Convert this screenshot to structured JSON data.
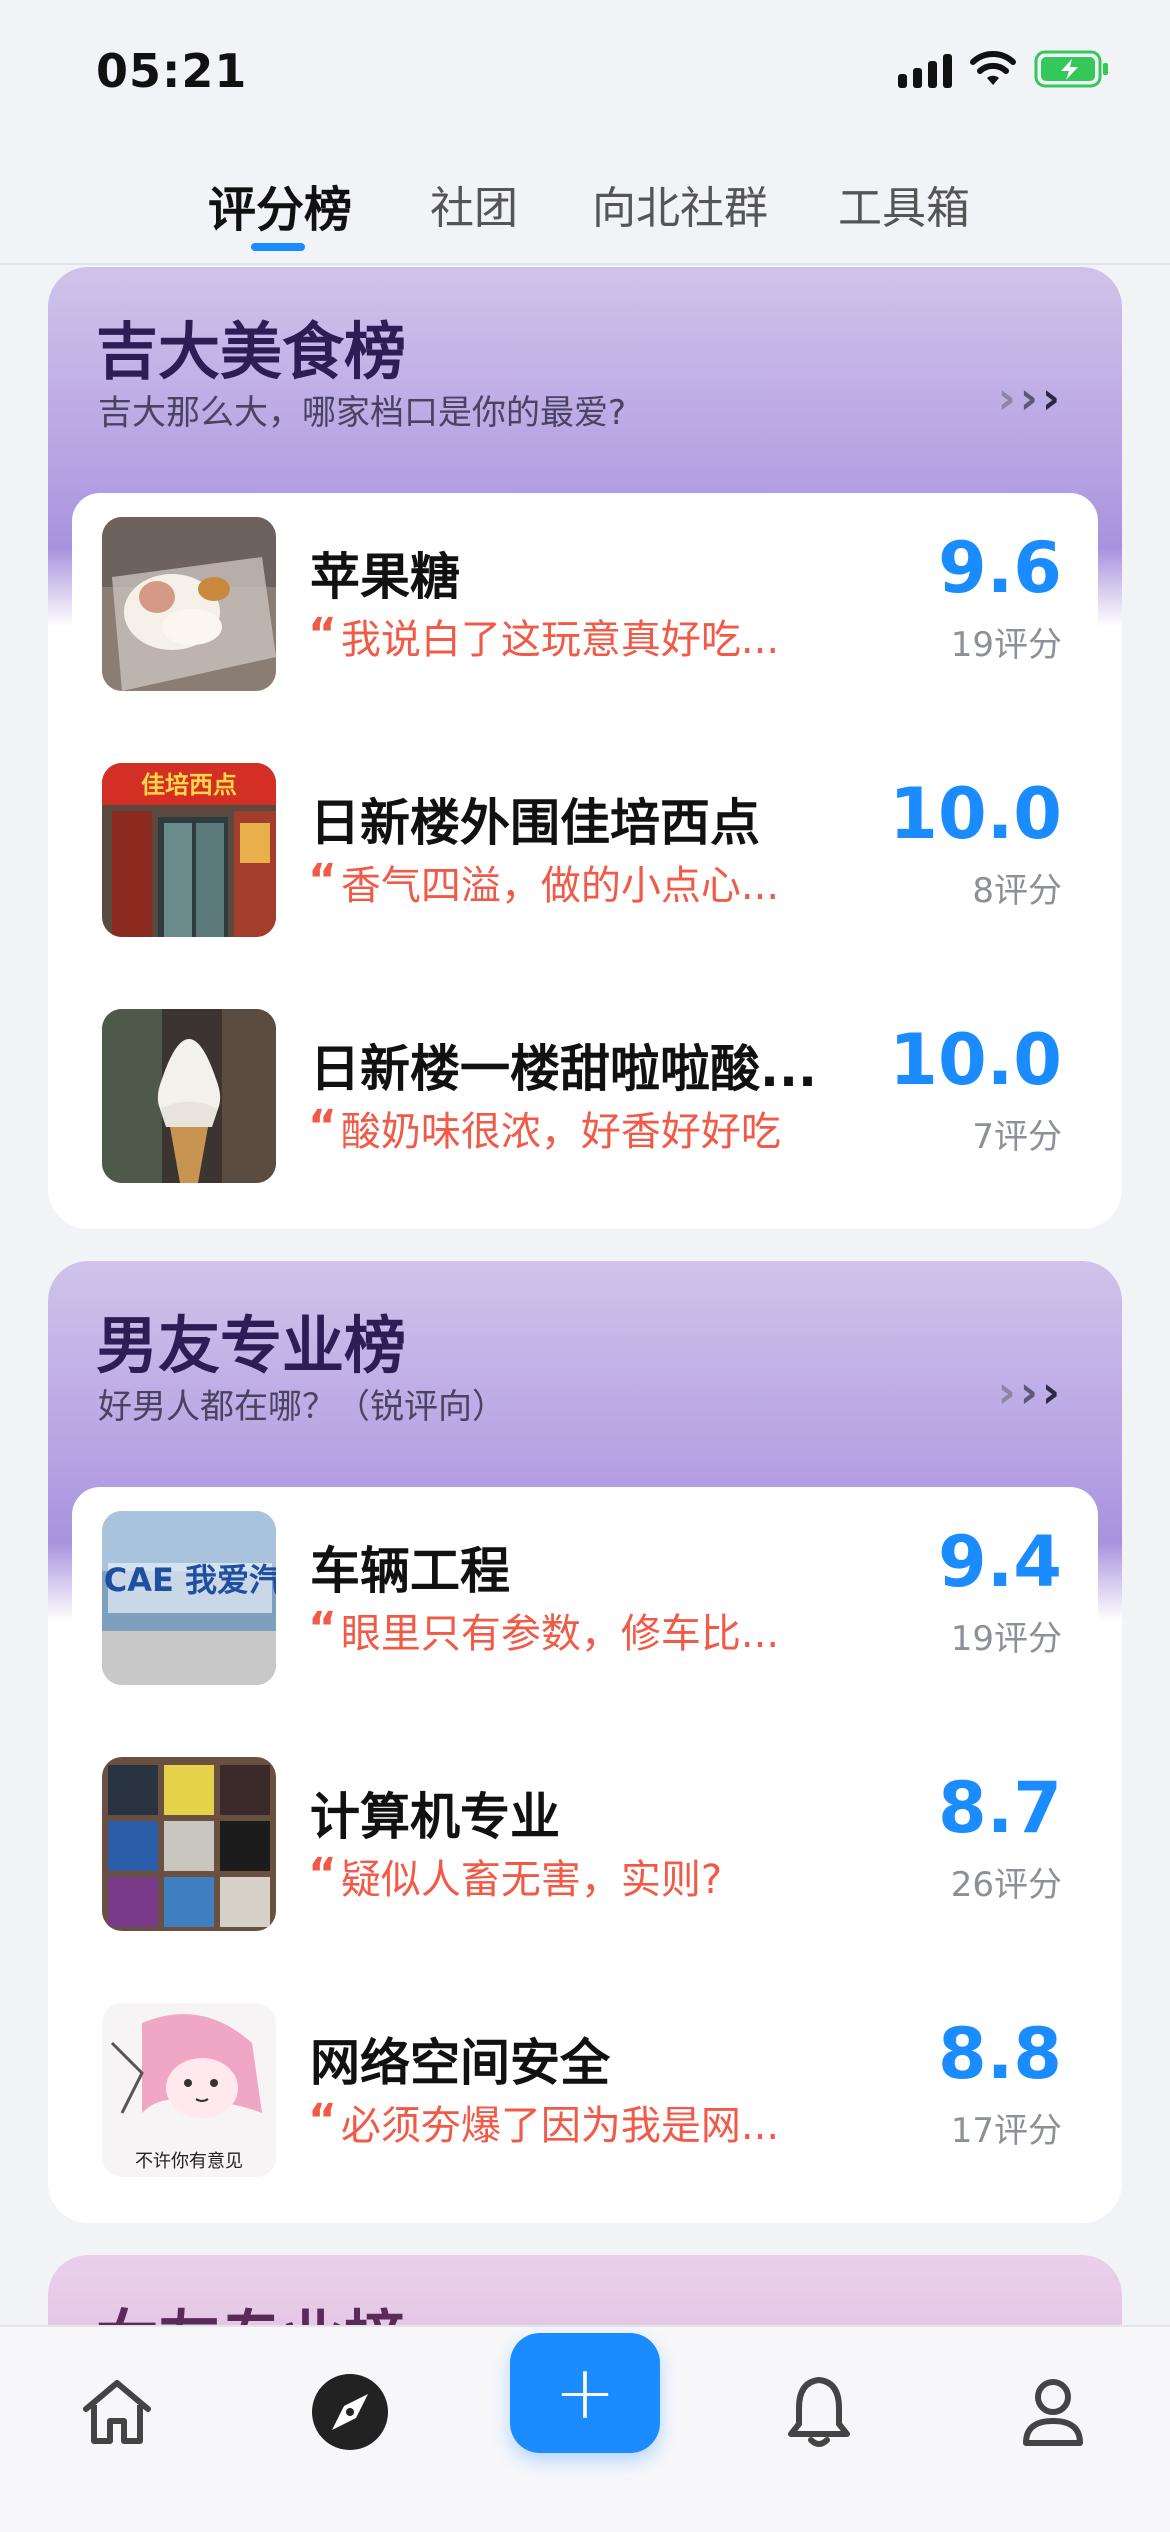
{
  "status": {
    "time": "05:21"
  },
  "tabs": [
    {
      "label": "评分榜"
    },
    {
      "label": "社团"
    },
    {
      "label": "向北社群"
    },
    {
      "label": "工具箱"
    }
  ],
  "boards": [
    {
      "title": "吉大美食榜",
      "subtitle": "吉大那么大，哪家档口是你的最爱?",
      "items": [
        {
          "name": "苹果糖",
          "quote": "我说白了这玩意真好吃...",
          "score": "9.6",
          "count": "19评分"
        },
        {
          "name": "日新楼外围佳培西点",
          "quote": "香气四溢，做的小点心...",
          "score": "10.0",
          "count": "8评分"
        },
        {
          "name": "日新楼一楼甜啦啦酸...",
          "quote": "酸奶味很浓，好香好好吃",
          "score": "10.0",
          "count": "7评分"
        }
      ]
    },
    {
      "title": "男友专业榜",
      "subtitle": "好男人都在哪？（锐评向）",
      "items": [
        {
          "name": "车辆工程",
          "quote": "眼里只有参数，修车比...",
          "score": "9.4",
          "count": "19评分"
        },
        {
          "name": "计算机专业",
          "quote": "疑似人畜无害，实则?",
          "score": "8.7",
          "count": "26评分"
        },
        {
          "name": "网络空间安全",
          "quote": "必须夯爆了因为我是网...",
          "score": "8.8",
          "count": "17评分"
        }
      ]
    },
    {
      "title": "女友专业榜"
    }
  ],
  "thumb_texts": {
    "car": "I❤CAE 我爱汽车",
    "meme": "不许你有意见",
    "store": "佳培西点"
  },
  "nav": {
    "add_label": "+",
    "icons": [
      "home-icon",
      "compass-icon",
      "bell-icon",
      "profile-icon"
    ]
  },
  "colors": {
    "accent": "#1a8cff",
    "quote": "#f05a47",
    "board_title": "#2c1d55"
  }
}
